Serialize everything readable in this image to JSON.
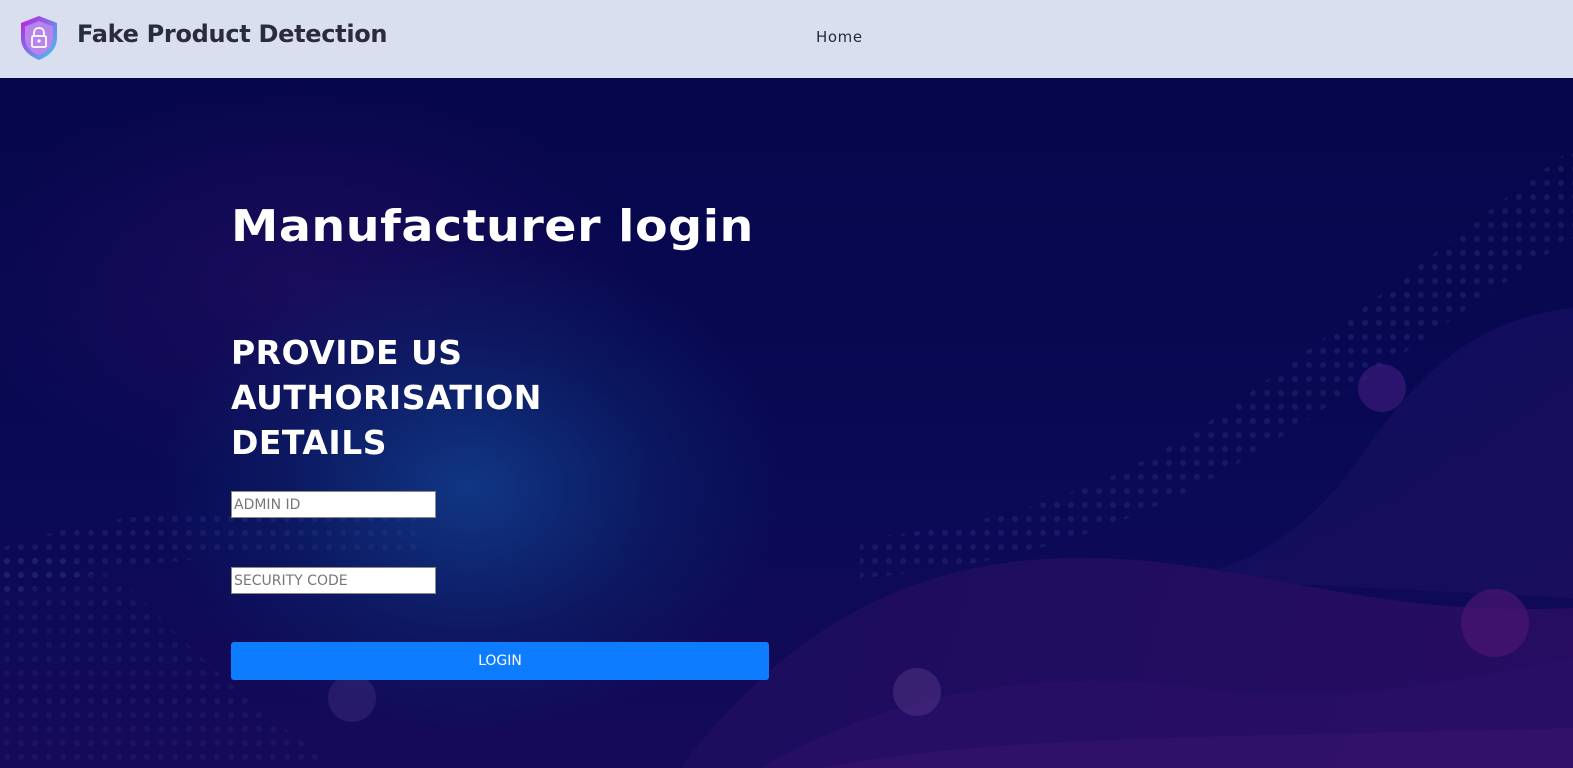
{
  "navbar": {
    "brand_title": "Fake Product Detection",
    "links": [
      {
        "label": "Home"
      }
    ]
  },
  "login": {
    "title": "Manufacturer login",
    "subtitle": "PROVIDE US AUTHORISATION DETAILS",
    "admin_id_placeholder": "ADMIN ID",
    "admin_id_value": "",
    "security_code_placeholder": "SECURITY CODE",
    "security_code_value": "",
    "button_label": "LOGIN"
  },
  "icons": {
    "brand": "shield-lock-icon"
  },
  "colors": {
    "navbar_bg": "#d9dfef",
    "hero_bg": "#07074a",
    "button_bg": "#0d7cff",
    "text_light": "#ffffff",
    "text_dark": "#2b2b3a"
  }
}
